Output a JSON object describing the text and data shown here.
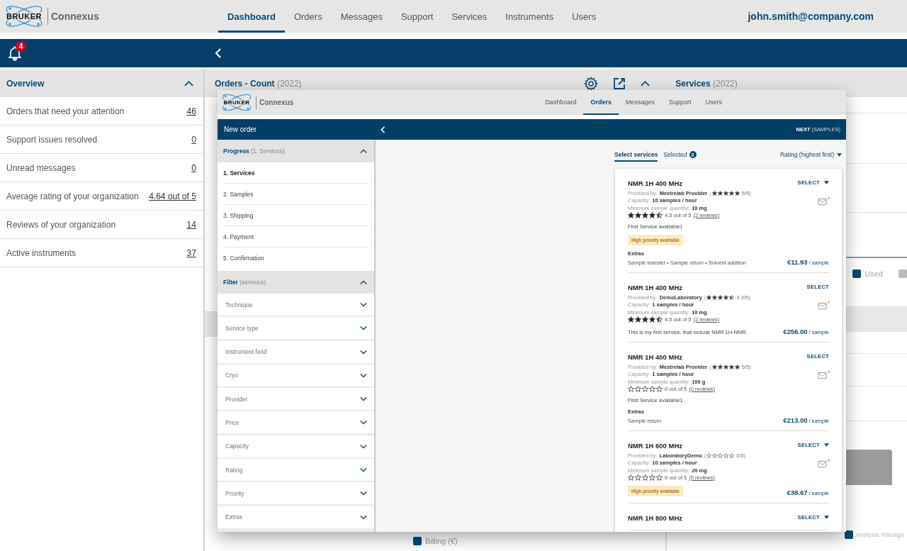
{
  "header": {
    "logo": "BRUKER",
    "app": "Connexus",
    "nav": [
      {
        "label": "Dashboard",
        "selected": true
      },
      {
        "label": "Orders",
        "selected": false
      },
      {
        "label": "Messages",
        "selected": false
      },
      {
        "label": "Support",
        "selected": false
      },
      {
        "label": "Services",
        "selected": false
      },
      {
        "label": "Instruments",
        "selected": false
      },
      {
        "label": "Users",
        "selected": false
      }
    ],
    "user": "john.smith@company.com"
  },
  "bar": {
    "notifications": "4"
  },
  "overview": {
    "title": "Overview",
    "expanded": true,
    "rows": [
      {
        "label": "Orders that need your attention",
        "value": "46"
      },
      {
        "label": "Support issues resolved",
        "value": "0"
      },
      {
        "label": "Unread messages",
        "value": "0"
      },
      {
        "label": "Average rating of your organization",
        "value": "4.64 out of 5"
      },
      {
        "label": "Reviews of your organization",
        "value": "14"
      },
      {
        "label": "Active instruments",
        "value": "37"
      }
    ]
  },
  "orders_panel": {
    "title": "Orders - Count",
    "year": "(2022)",
    "expanded": true,
    "legend": "Billing (€)"
  },
  "services_panel": {
    "title": "Services",
    "year": "(2022)",
    "legend": [
      {
        "label": "Used",
        "color": "#0b4a75"
      }
    ],
    "bottom_legend": "Analysis manage"
  },
  "order_window": {
    "logo": "BRUKER",
    "app": "Connexus",
    "nav": [
      {
        "label": "Dashboard",
        "selected": false
      },
      {
        "label": "Orders",
        "selected": true
      },
      {
        "label": "Messages",
        "selected": false
      },
      {
        "label": "Support",
        "selected": false
      },
      {
        "label": "Users",
        "selected": false
      }
    ],
    "title": "New order",
    "next": "NEXT",
    "next_step": "(SAMPLES)",
    "progress": {
      "title": "Progress",
      "current": "(1. Services)",
      "expanded": true,
      "steps": [
        {
          "label": "1. Services",
          "selected": true
        },
        {
          "label": "2. Samples",
          "selected": false
        },
        {
          "label": "3. Shipping",
          "selected": false
        },
        {
          "label": "4. Payment",
          "selected": false
        },
        {
          "label": "5. Confirmation",
          "selected": false
        }
      ]
    },
    "filter": {
      "title": "Filter",
      "hint": "(services)",
      "expanded": true,
      "items": [
        {
          "label": "Technique",
          "expanded": false
        },
        {
          "label": "Service type",
          "expanded": false
        },
        {
          "label": "Instrument field",
          "expanded": false
        },
        {
          "label": "Cryo",
          "expanded": false
        },
        {
          "label": "Provider",
          "expanded": false
        },
        {
          "label": "Price",
          "expanded": false
        },
        {
          "label": "Capacity",
          "expanded": false
        },
        {
          "label": "Rating",
          "expanded": false
        },
        {
          "label": "Priority",
          "expanded": false
        },
        {
          "label": "Extras",
          "expanded": false
        }
      ]
    },
    "tabs": [
      {
        "label": "Select services",
        "selected": true
      },
      {
        "label": "Selected",
        "count": "0",
        "selected": false
      }
    ],
    "sort": "Rating (highest first)",
    "services": [
      {
        "name": "NMR 1H 400 MHz",
        "action": "SELECT",
        "menu": true,
        "provider_label": "Provided by:",
        "provider": "Mestrelab Provider",
        "provider_rating": {
          "open": "(",
          "stars": 5,
          "score": "5/5)"
        },
        "capacity_label": "Capacity:",
        "capacity": "10 samples / hour",
        "quantity_label": "Minimum sample quantity:",
        "quantity": "10 mg",
        "stars": 4.5,
        "rating": "4.5 out of 5",
        "reviews": "(2 reviews)",
        "description": "First Service available1",
        "priority": "High priority available",
        "extras_title": "Extras",
        "extras": "Sample transfer • Sample return • Solvent addition",
        "price": "€11.93",
        "unit": "/ sample"
      },
      {
        "name": "NMR 1H 400 MHz",
        "action": "SELECT",
        "menu": false,
        "provider_label": "Provided by:",
        "provider": "DemoLaboratory",
        "provider_rating": {
          "open": "(",
          "stars": 4.5,
          "score": "4.3/5)"
        },
        "capacity_label": "Capacity:",
        "capacity": "1 samples / hour",
        "quantity_label": "Minimum sample quantity:",
        "quantity": "10 mg",
        "stars": 4.5,
        "rating": "4.5 out of 5",
        "reviews": "(2 reviews)",
        "description": "This is my first service, that include NMR 1H-NMR.",
        "price": "€256.00",
        "unit": "/ sample"
      },
      {
        "name": "NMR 1H 400 MHz",
        "action": "SELECT",
        "menu": false,
        "provider_label": "Provided by:",
        "provider": "Mestrelab Provider",
        "provider_rating": {
          "open": "(",
          "stars": 5,
          "score": "5/5)"
        },
        "capacity_label": "Capacity:",
        "capacity": "1 samples / hour",
        "quantity_label": "Minimum sample quantity:",
        "quantity": "100 g",
        "stars": 0,
        "rating": "0 out of 5",
        "reviews": "(0 reviews)",
        "description": "First Service available1",
        "extras_title": "Extras",
        "extras": "Sample return",
        "price": "€213.00",
        "unit": "/ sample"
      },
      {
        "name": "NMR 1H 600 MHz",
        "action": "SELECT",
        "menu": true,
        "provider_label": "Provided by:",
        "provider": "LaboratoryDemo",
        "provider_rating": {
          "open": "(",
          "stars": 0,
          "score": "0/5)"
        },
        "capacity_label": "Capacity:",
        "capacity": "10 samples / hour",
        "quantity_label": "Minimum sample quantity:",
        "quantity": "20 mg",
        "stars": 0,
        "rating": "0 out of 5",
        "reviews": "(0 reviews)",
        "priority": "High priority available",
        "price": "€38.67",
        "unit": "/ sample"
      },
      {
        "name": "NMR 1H 800 MHz",
        "action": "SELECT",
        "menu": true
      }
    ]
  }
}
